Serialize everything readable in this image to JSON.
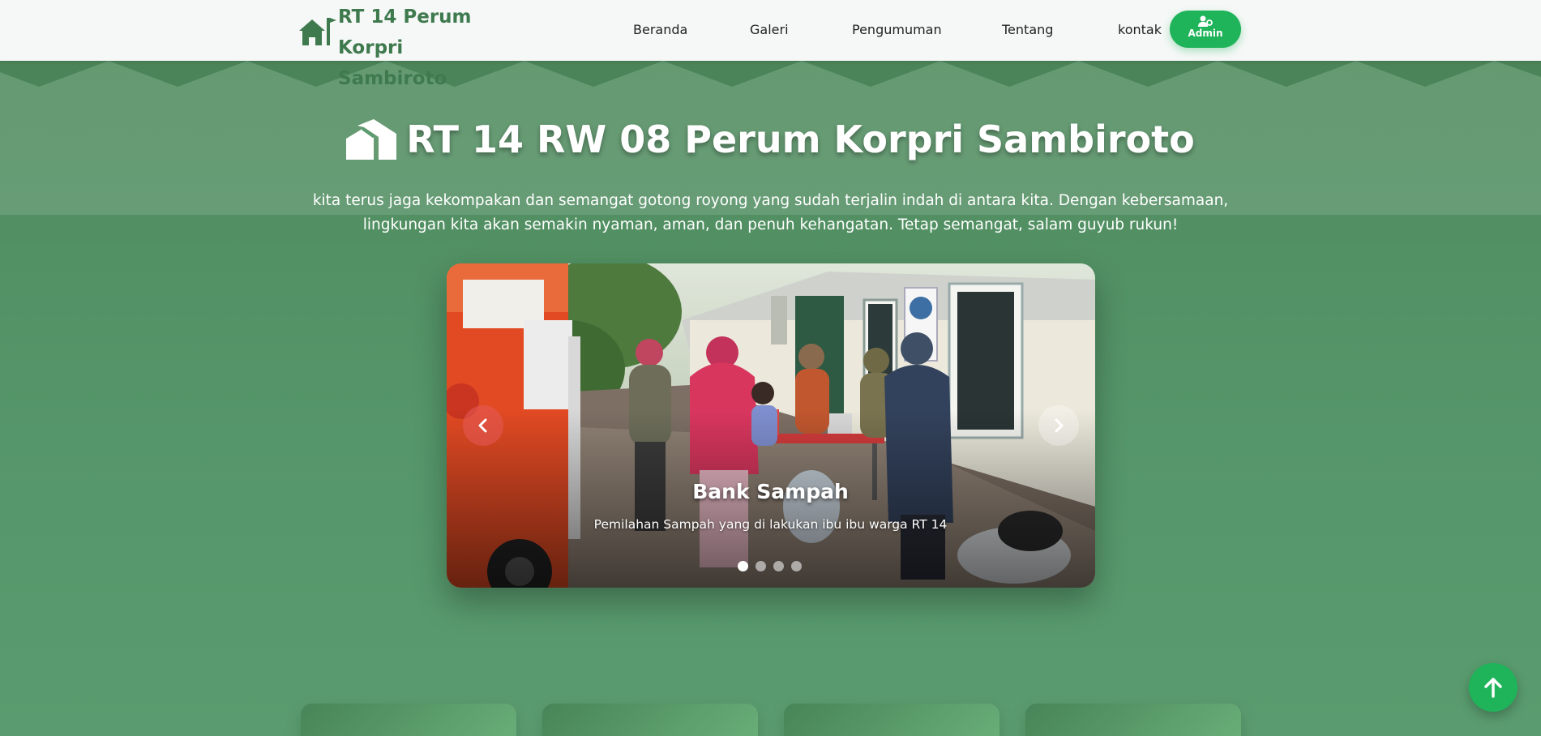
{
  "navbar": {
    "brand_line1": "RT 14 Perum Korpri",
    "brand_line2": "Sambiroto",
    "brand_icon": "house-flag-icon",
    "links": [
      "Beranda",
      "Galeri",
      "Pengumuman",
      "Tentang",
      "kontak"
    ],
    "admin_label": "Admin",
    "admin_icon": "user-cog-icon"
  },
  "hero": {
    "title": "RT 14 RW 08 Perum Korpri Sambiroto",
    "title_icon": "houses-icon",
    "description": "kita terus jaga kekompakan dan semangat gotong royong yang sudah terjalin indah di antara kita. Dengan kebersamaan, lingkungan kita akan semakin nyaman, aman, dan penuh kehangatan. Tetap semangat, salam guyub rukun!"
  },
  "carousel": {
    "slide_title": "Bank Sampah",
    "slide_caption": "Pemilahan Sampah yang di lakukan ibu ibu warga RT 14",
    "slide_count": 4,
    "active_index": 0,
    "prev_icon": "chevron-left-icon",
    "next_icon": "chevron-right-icon"
  },
  "back_to_top_icon": "arrow-up-icon",
  "colors": {
    "brand_green": "#3f7a4f",
    "accent_green": "#1fb35a",
    "background_green": "#55966a"
  }
}
